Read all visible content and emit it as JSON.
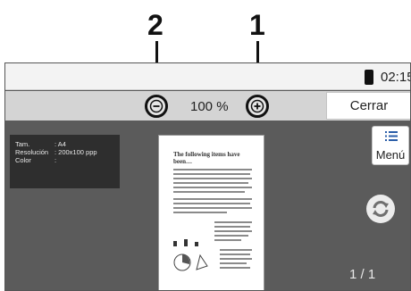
{
  "callouts": {
    "zoom_out": "2",
    "zoom_in": "1"
  },
  "status": {
    "time": "02:15",
    "icon": "phone-icon"
  },
  "toolbar": {
    "zoom_out_icon": "zoom-out-icon",
    "zoom_value": "100 %",
    "zoom_in_icon": "zoom-in-icon",
    "close_label": "Cerrar"
  },
  "info": {
    "rows": [
      {
        "key": "Tam.",
        "value": ": A4"
      },
      {
        "key": "Resolución",
        "value": ": 200x100 ppp"
      },
      {
        "key": "Color",
        "value": ":"
      }
    ]
  },
  "preview": {
    "title": "The following items have been…"
  },
  "menu": {
    "label": "Menú",
    "icon": "list-icon"
  },
  "rotate": {
    "icon": "rotate-icon"
  },
  "page": {
    "indicator": "1 / 1"
  }
}
